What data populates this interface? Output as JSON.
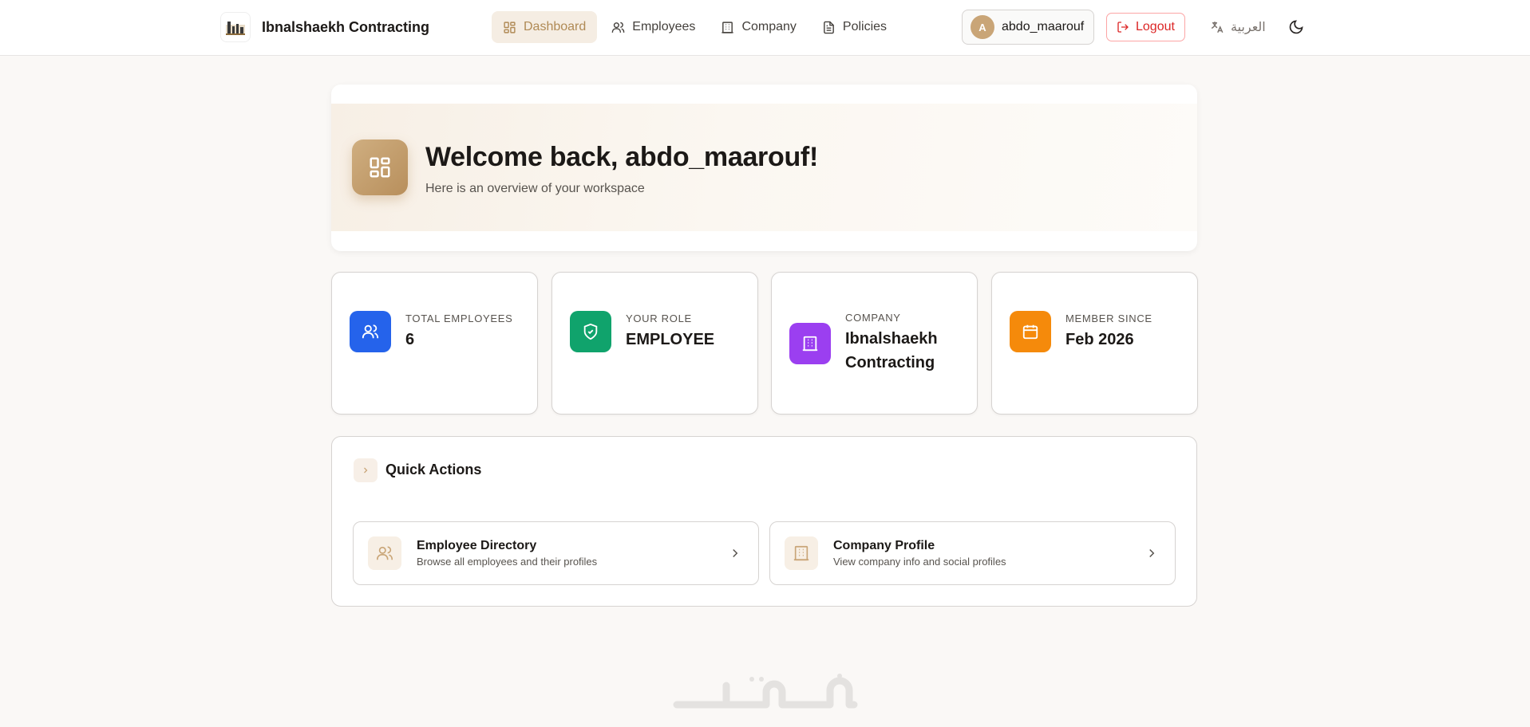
{
  "brand": {
    "name": "Ibnalshaekh Contracting"
  },
  "nav": [
    {
      "label": "Dashboard",
      "icon": "dashboard-icon",
      "active": true
    },
    {
      "label": "Employees",
      "icon": "users-icon",
      "active": false
    },
    {
      "label": "Company",
      "icon": "building-icon",
      "active": false
    },
    {
      "label": "Policies",
      "icon": "document-icon",
      "active": false
    }
  ],
  "user": {
    "initial": "A",
    "name": "abdo_maarouf"
  },
  "logout_label": "Logout",
  "language_label": "العربية",
  "welcome": {
    "title": "Welcome back, abdo_maarouf!",
    "subtitle": "Here is an overview of your workspace"
  },
  "stats": [
    {
      "label": "Total Employees",
      "value": "6",
      "icon": "users-icon",
      "color": "#2563eb"
    },
    {
      "label": "Your Role",
      "value": "EMPLOYEE",
      "icon": "shield-check-icon",
      "color": "#10a36c"
    },
    {
      "label": "Company",
      "value": "Ibnalshaekh Contracting",
      "icon": "building-icon",
      "color": "#9b3ff0"
    },
    {
      "label": "Member Since",
      "value": "Feb 2026",
      "icon": "calendar-icon",
      "color": "#f58a0b"
    }
  ],
  "quick_actions": {
    "title": "Quick Actions",
    "items": [
      {
        "title": "Employee Directory",
        "subtitle": "Browse all employees and their profiles",
        "icon": "users-icon"
      },
      {
        "title": "Company Profile",
        "subtitle": "View company info and social profiles",
        "icon": "building-icon"
      }
    ]
  },
  "colors": {
    "accent": "#b08a55",
    "accent_bg": "#f5ede3",
    "danger": "#dc2626"
  }
}
